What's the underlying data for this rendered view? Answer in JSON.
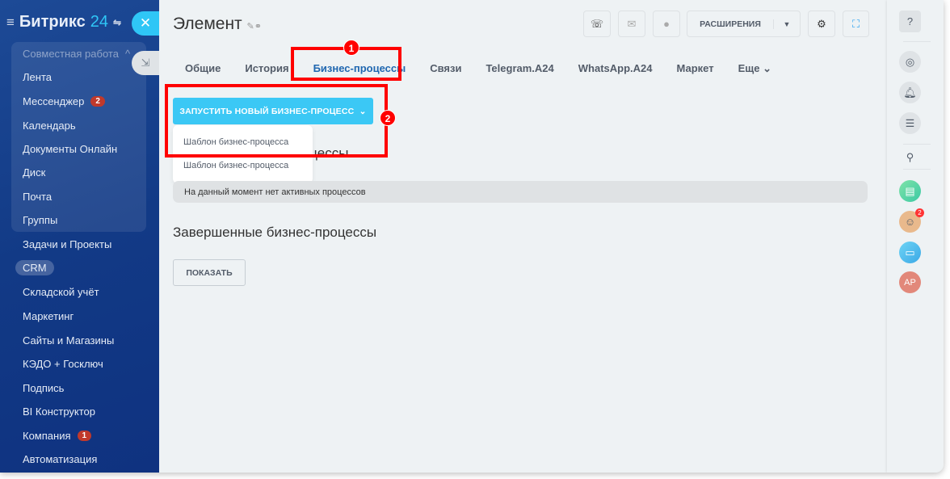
{
  "sidebar": {
    "logo_text": "Битрикс",
    "logo_num": "24",
    "group_title": "Совместная работа",
    "items": [
      {
        "label": "Лента"
      },
      {
        "label": "Мессенджер",
        "badge": "2"
      },
      {
        "label": "Календарь"
      },
      {
        "label": "Документы Онлайн"
      },
      {
        "label": "Диск"
      },
      {
        "label": "Почта"
      },
      {
        "label": "Группы"
      },
      {
        "label": "Задачи и Проекты"
      },
      {
        "label": "CRM"
      },
      {
        "label": "Складской учёт"
      },
      {
        "label": "Маркетинг"
      },
      {
        "label": "Сайты и Магазины"
      },
      {
        "label": "КЭДО + Госключ"
      },
      {
        "label": "Подпись"
      },
      {
        "label": "BI Конструктор"
      },
      {
        "label": "Компания",
        "badge": "1"
      },
      {
        "label": "Автоматизация"
      }
    ]
  },
  "header": {
    "title": "Элемент",
    "extensions_label": "РАСШИРЕНИЯ"
  },
  "tabs": [
    "Общие",
    "История",
    "Бизнес-процессы",
    "Связи",
    "Telegram.A24",
    "WhatsApp.A24",
    "Маркет",
    "Еще"
  ],
  "run_button": "ЗАПУСТИТЬ НОВЫЙ БИЗНЕС-ПРОЦЕСС",
  "dropdown": [
    "Шаблон бизнес-процесса",
    "Шаблон бизнес-процесса"
  ],
  "active_heading": "Активные бизнес-процессы",
  "no_active": "На данный момент нет активных процессов",
  "completed_heading": "Завершенные бизнес-процессы",
  "show_button": "ПОКАЗАТЬ",
  "annotations": [
    "1",
    "2"
  ],
  "right_bar": {
    "avatar_initials": "AP",
    "chat_badge": "2"
  },
  "colors": {
    "accent": "#3bc8f5",
    "highlight": "#ff0000",
    "active_tab": "#2067b0"
  }
}
